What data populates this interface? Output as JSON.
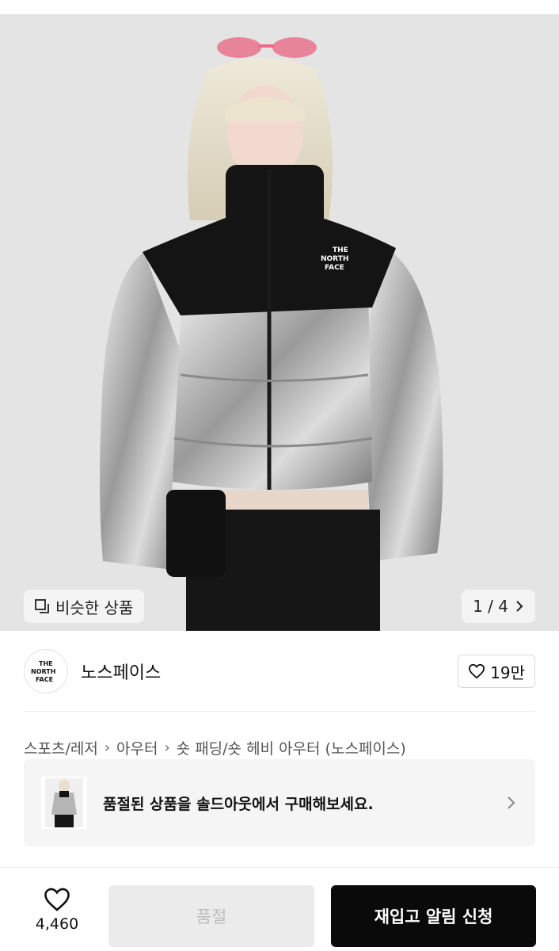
{
  "gallery": {
    "similar_label": "비슷한 상품",
    "pager_text": "1 / 4",
    "logo_text_line1": "THE",
    "logo_text_line2": "NORTH",
    "logo_text_line3": "FACE"
  },
  "brand": {
    "name": "노스페이스",
    "logo_line1": "THE",
    "logo_line2": "NORTH",
    "logo_line3": "FACE",
    "like_count": "19만"
  },
  "breadcrumb": [
    "스포츠/레저",
    "아우터",
    "숏 패딩/숏 헤비 아우터 (노스페이스)"
  ],
  "banner": {
    "text": "품절된 상품을 솔드아웃에서 구매해보세요."
  },
  "bottom_bar": {
    "wish_count": "4,460",
    "soldout_label": "품절",
    "restock_label": "재입고 알림 신청"
  },
  "icons": [
    "similar-icon",
    "chevron-right-icon",
    "heart-icon"
  ],
  "colors": {
    "primary_button": "#0a0a0a",
    "disabled_button": "#ebebeb"
  }
}
